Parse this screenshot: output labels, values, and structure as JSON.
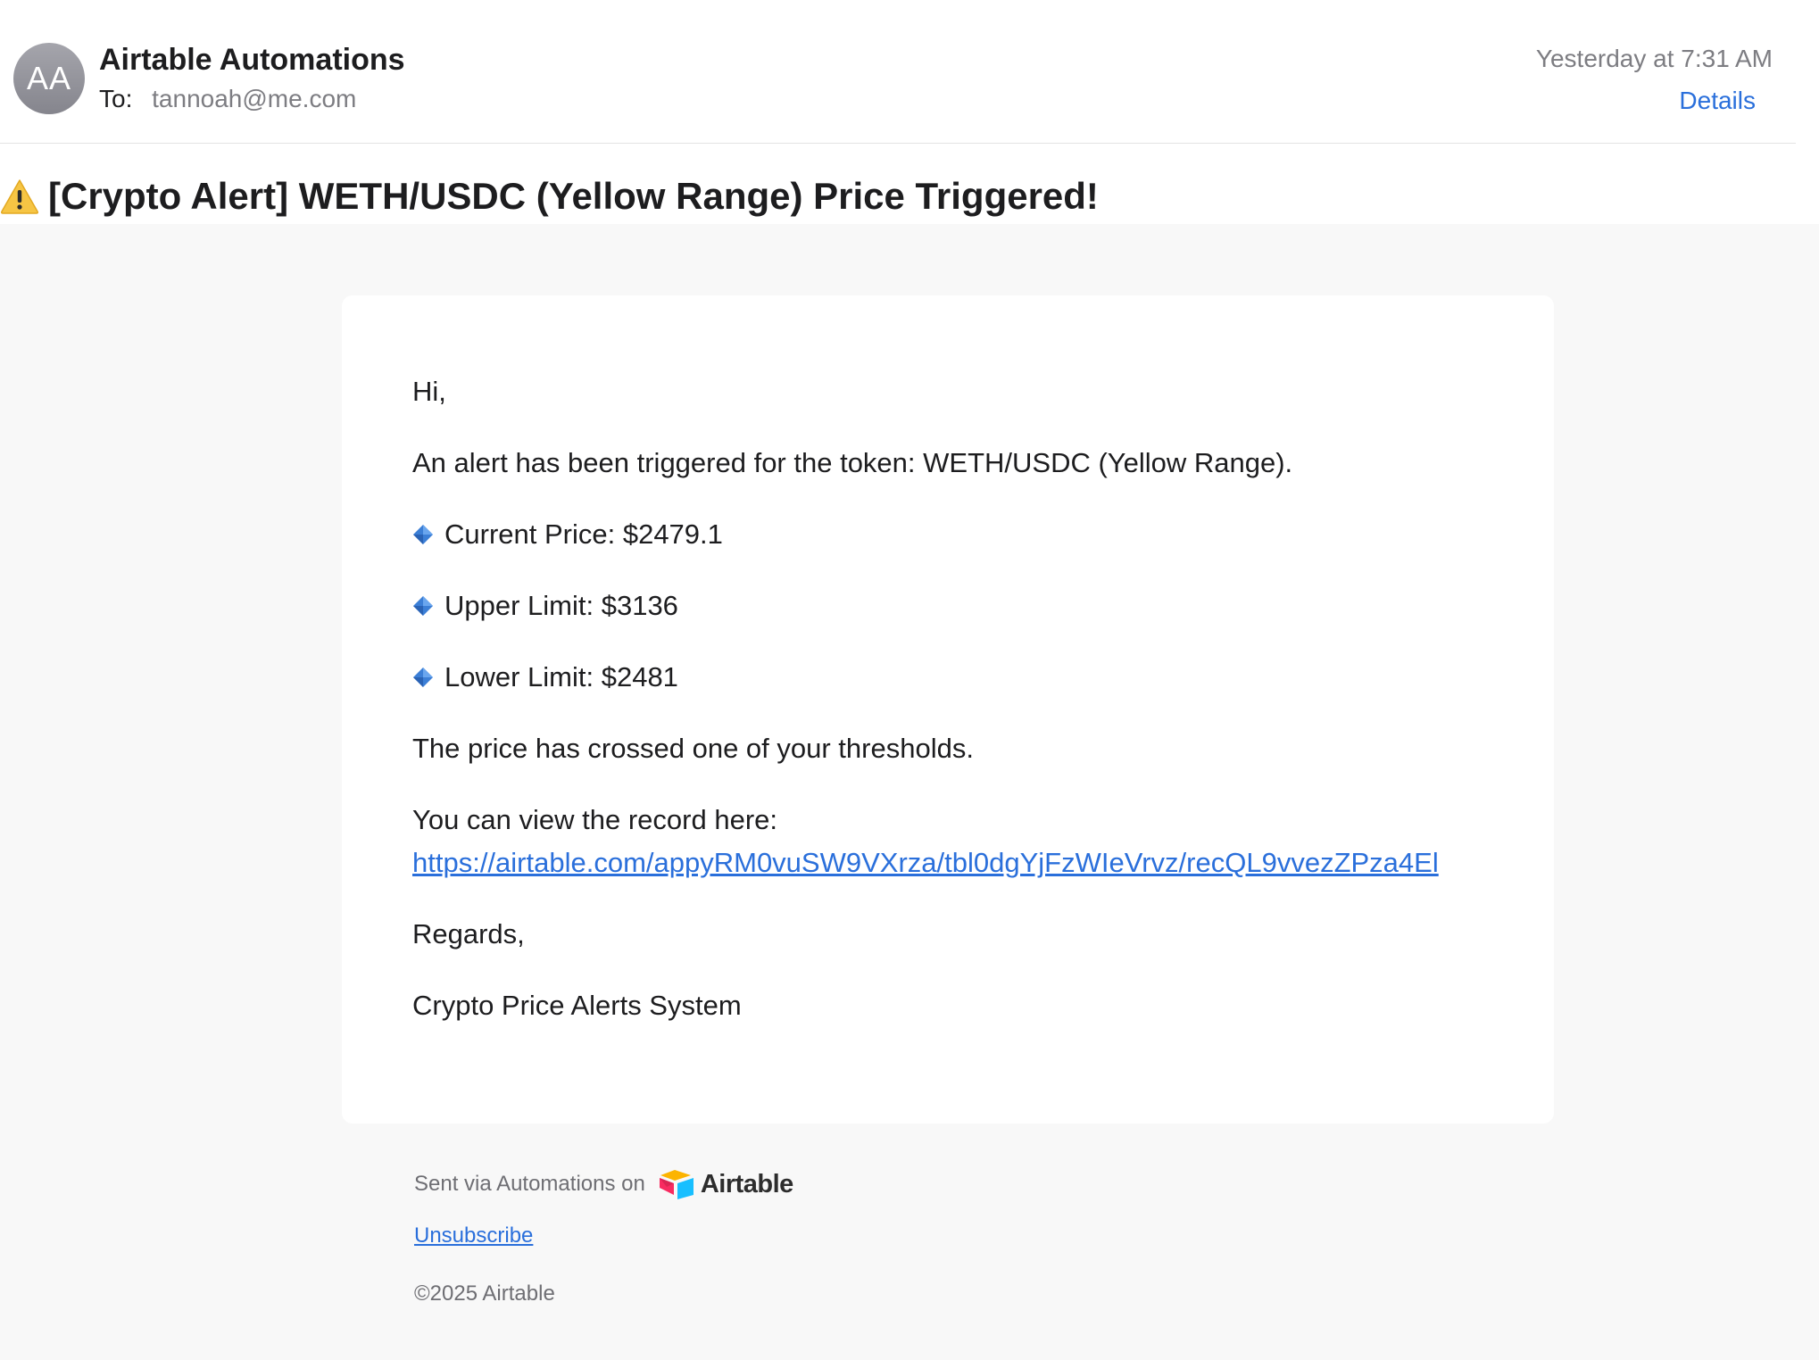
{
  "header": {
    "avatar_initials": "AA",
    "sender_name": "Airtable Automations",
    "to_label": "To:",
    "to_address": "tannoah@me.com",
    "timestamp": "Yesterday at 7:31 AM",
    "details_label": "Details"
  },
  "subject": {
    "icon": "warning-icon",
    "text": "[Crypto Alert] WETH/USDC (Yellow Range) Price Triggered!"
  },
  "message": {
    "greeting": "Hi,",
    "alert_line": "An alert has been triggered for the token: WETH/USDC (Yellow Range).",
    "bullet_icon": "blue-diamond-icon",
    "current_price": "Current Price: $2479.1",
    "upper_limit": "Upper Limit: $3136",
    "lower_limit": "Lower Limit: $2481",
    "crossed_line": "The price has crossed one of your thresholds.",
    "view_record_line": "You can view the record here:",
    "record_url": "https://airtable.com/appyRM0vuSW9VXrza/tbl0dgYjFzWIeVrvz/recQL9vvezZPza4El",
    "regards": "Regards,",
    "signature": "Crypto Price Alerts System"
  },
  "footer": {
    "sent_via": "Sent via Automations on",
    "brand_name": "Airtable",
    "unsubscribe_label": "Unsubscribe",
    "copyright": "©2025 Airtable"
  },
  "colors": {
    "link": "#2a6fdb",
    "page_background": "#f8f8f8",
    "card_background": "#ffffff",
    "secondary_text": "#7d7d82"
  }
}
